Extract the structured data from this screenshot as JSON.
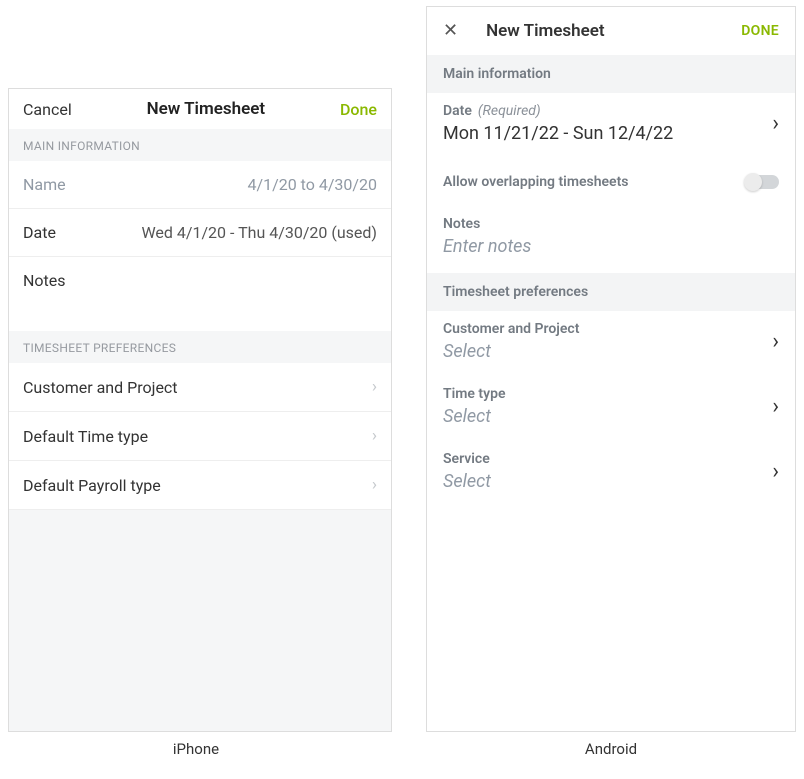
{
  "iphone": {
    "header": {
      "cancel": "Cancel",
      "title": "New Timesheet",
      "done": "Done"
    },
    "section_main": "MAIN INFORMATION",
    "rows": {
      "name": {
        "label": "Name",
        "value": "4/1/20 to 4/30/20"
      },
      "date": {
        "label": "Date",
        "value": "Wed 4/1/20 - Thu 4/30/20 (used)"
      },
      "notes": {
        "label": "Notes"
      }
    },
    "section_prefs": "TIMESHEET PREFERENCES",
    "prefs": {
      "customer": "Customer and Project",
      "time_type": "Default Time type",
      "payroll_type": "Default Payroll type"
    },
    "caption": "iPhone"
  },
  "android": {
    "header": {
      "title": "New Timesheet",
      "done": "DONE"
    },
    "section_main": "Main information",
    "rows": {
      "date": {
        "label": "Date",
        "required": "(Required)",
        "value": "Mon 11/21/22 - Sun 12/4/22"
      },
      "overlap": {
        "label": "Allow overlapping timesheets"
      },
      "notes": {
        "label": "Notes",
        "placeholder": "Enter notes"
      }
    },
    "section_prefs": "Timesheet preferences",
    "prefs": {
      "customer": {
        "label": "Customer and Project",
        "value": "Select"
      },
      "time_type": {
        "label": "Time type",
        "value": "Select"
      },
      "service": {
        "label": "Service",
        "value": "Select"
      }
    },
    "caption": "Android"
  }
}
